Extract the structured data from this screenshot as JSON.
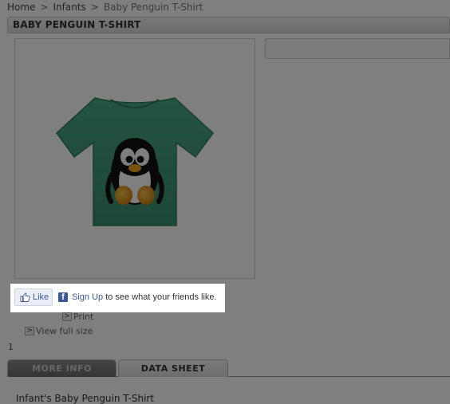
{
  "breadcrumb": {
    "home": "Home",
    "separator": ">",
    "category": "Infants",
    "current": "Baby Penguin T-Shirt"
  },
  "product": {
    "title": "BABY PENGUIN T-SHIRT",
    "description": "Infant's Baby Penguin T-Shirt",
    "image": {
      "shirt_color": "#3f9a78",
      "subject": "penguin-illustration"
    }
  },
  "facebook": {
    "like_label": "Like",
    "f_logo": "f",
    "signup_link": "Sign Up",
    "signup_text": " to see what your friends like.",
    "brand_color": "#3b5998"
  },
  "actions": {
    "arrow_glyph": ">",
    "print_label": "Print",
    "view_full_size_label": "View full size"
  },
  "counter": "1",
  "tabs": {
    "more_info": "MORE INFO",
    "data_sheet": "DATA SHEET"
  },
  "colors": {
    "overlay": "rgba(0,0,0,0.5)"
  }
}
